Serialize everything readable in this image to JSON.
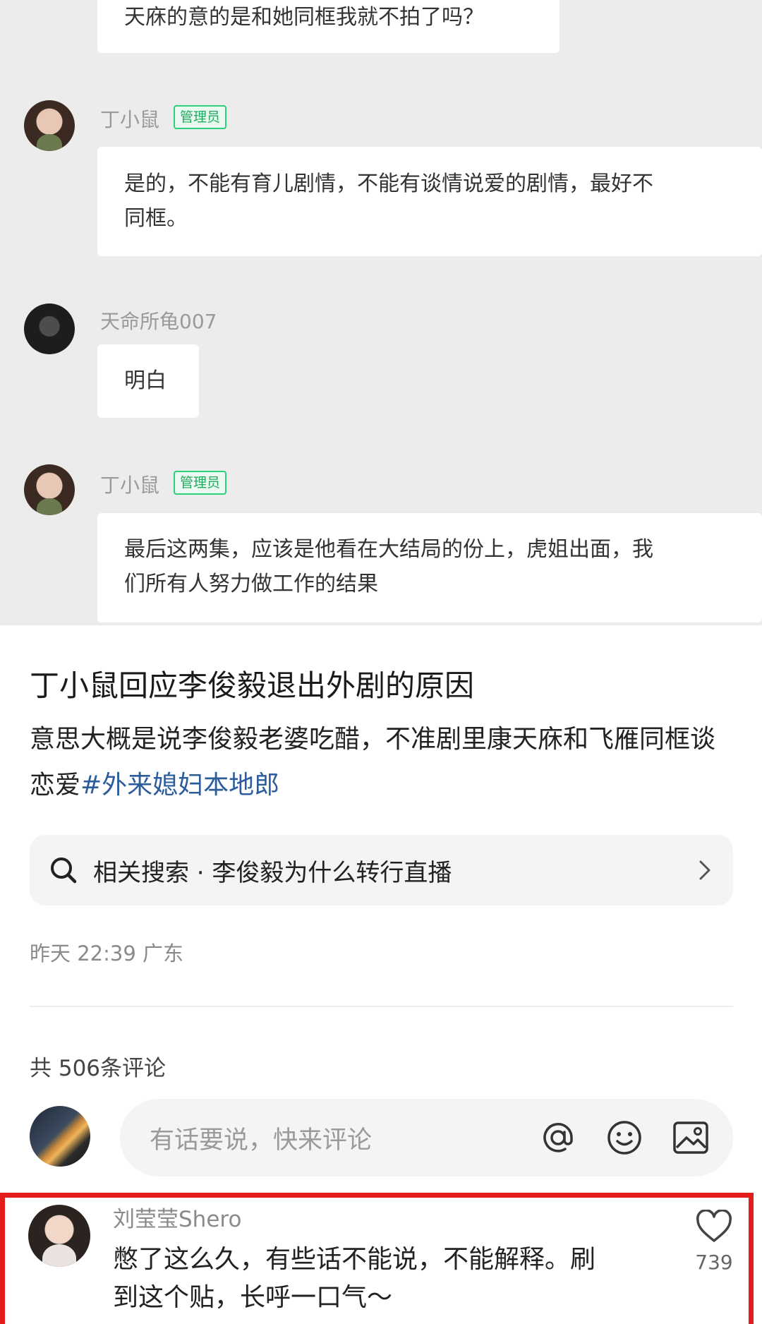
{
  "chat": {
    "messages": [
      {
        "sender": "",
        "badge": "",
        "lines": [
          "天庥的意的是和她同框我就不拍了吗？"
        ]
      },
      {
        "sender": "丁小鼠",
        "badge": "管理员",
        "lines": [
          "是的，不能有育儿剧情，不能有谈情说爱的剧情，最好不",
          "同框。"
        ]
      },
      {
        "sender": "天命所龟007",
        "badge": "",
        "lines": [
          "明白"
        ]
      },
      {
        "sender": "丁小鼠",
        "badge": "管理员",
        "lines": [
          "最后这两集，应该是他看在大结局的份上，虎姐出面，我",
          "们所有人努力做工作的结果"
        ]
      }
    ]
  },
  "post": {
    "title": "丁小鼠回应李俊毅退出外剧的原因",
    "body": "意思大概是说李俊毅老婆吃醋，不准剧里康天庥和飞雁同框谈恋爱",
    "hashtag": "#外来媳妇本地郎",
    "related_search": "相关搜索 · 李俊毅为什么转行直播",
    "meta": "昨天 22:39 广东"
  },
  "comments": {
    "count_label": "共 506条评论",
    "input_placeholder": "有话要说，快来评论",
    "input_icons": [
      "at-icon",
      "emoji-icon",
      "image-icon"
    ],
    "items": [
      {
        "author": "刘莹莹Shero",
        "lines": [
          "憋了这么久，有些话不能说，不能解释。刷",
          "到这个贴，长呼一口气～"
        ],
        "likes": "739"
      }
    ]
  },
  "colors": {
    "hashtag": "#2b5c9c",
    "admin_badge": "#1faa5d",
    "highlight_border": "#e51c1c"
  }
}
